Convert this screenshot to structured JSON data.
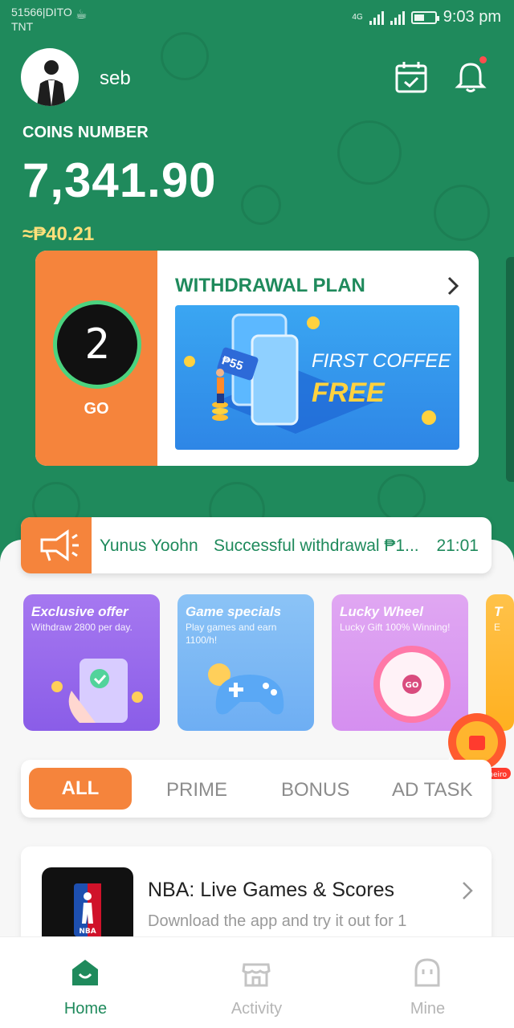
{
  "status_bar": {
    "carrier_line1": "51566|DITO",
    "carrier_line2": "TNT",
    "network": "4G",
    "time": "9:03 pm",
    "battery_level": 0.5
  },
  "header": {
    "username": "seb",
    "has_notification": true
  },
  "coins": {
    "label": "COINS NUMBER",
    "value": "7,341.90",
    "fiat": "≈₱40.21"
  },
  "withdrawal_plan": {
    "countdown": "2",
    "go_label": "GO",
    "title": "WITHDRAWAL PLAN",
    "banner_line1": "FIRST COFFEE",
    "banner_line2": "FREE",
    "banner_badge": "₱55"
  },
  "ticker": {
    "name": "Yunus Yoohn",
    "message": "Successful withdrawal ₱1...",
    "time": "21:01"
  },
  "promos": [
    {
      "title": "Exclusive offer",
      "subtitle": "Withdraw 2800 per day.",
      "color_top": "#a678f0",
      "color_bottom": "#8a5de8"
    },
    {
      "title": "Game specials",
      "subtitle": "Play games and earn 1100/h!",
      "color_top": "#8bc3f6",
      "color_bottom": "#6eaef3"
    },
    {
      "title": "Lucky Wheel",
      "subtitle": "Lucky Gift 100% Winning!",
      "color_top": "#e0a7f2",
      "color_bottom": "#d58ff0"
    },
    {
      "title": "T",
      "subtitle": "E",
      "color_top": "#ffc24a",
      "color_bottom": "#ffb020"
    }
  ],
  "float_button": {
    "label": "receber dinheiro",
    "wheel_center": "GO"
  },
  "tabs": {
    "items": [
      "ALL",
      "PRIME",
      "BONUS",
      "AD TASK"
    ],
    "active": "ALL"
  },
  "app_card": {
    "title": "NBA: Live Games & Scores",
    "description": "Download the app and try it out for 1",
    "icon_label": "NBA"
  },
  "bottom_nav": [
    {
      "label": "Home",
      "active": true
    },
    {
      "label": "Activity",
      "active": false
    },
    {
      "label": "Mine",
      "active": false
    }
  ],
  "colors": {
    "brand_green": "#1f8a5c",
    "accent_orange": "#f5843c",
    "gold": "#ffe07a"
  }
}
